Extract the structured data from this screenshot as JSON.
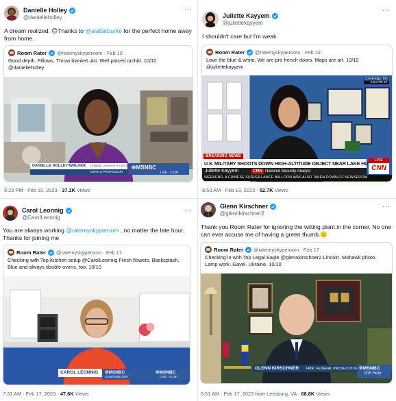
{
  "tweets": [
    {
      "name": "Danielle Holley",
      "handle": "@danielleholley",
      "text_pre": "A dream realized. 😊Thanks to ",
      "mention": "@alafairburke",
      "text_post": " for the perfect home away from home.",
      "quote": {
        "name": "Room Rater",
        "handle": "@ratemyskyperoom · Feb 10",
        "text": "Good depth. Pillows. Throw blanket. Art. Well placed orchid. 10/10 @danielleholley"
      },
      "lower_third": {
        "name": "DANIELLE HOLLEY-WALKER",
        "title": "DEAN & PROFESSOR",
        "org": "HOWARD UNIVERSITY LAW SCHOOL",
        "network": "MSNBC",
        "live": "LIVE",
        "time": "2:12P"
      },
      "meta_time": "5:23 PM · Feb 10, 2023 · ",
      "meta_views": "37.1K",
      "meta_suffix": " Views"
    },
    {
      "name": "Juliette Kayyem",
      "handle": "@juliettekayyem",
      "text": "I shouldn't care but I'm weak.",
      "quote": {
        "name": "Room Rater",
        "handle": "@ratemyskyperoom · Feb 12",
        "text": "Love the blue & white. We are pro french doors. Maps are art. 10/10 @juliettekayyem"
      },
      "lower_third": {
        "location": "Cambridge, MA",
        "clock": "5:54 PM ET",
        "breaking": "BREAKING NEWS",
        "headline": "U.S. MILITARY SHOOTS DOWN HIGH-ALTITUDE OBJECT NEAR LAKE HURON",
        "name": "Juliette Kayyem",
        "network": "CNN",
        "title": "National Security Analyst",
        "live": "LIVE",
        "ticker": "WEEKEND, A CHINESE SURVEILLANCE BALLOON WAS ALSO TAKEN DOWN OF NEWSROOM"
      },
      "meta_time": "8:53 AM · Feb 13, 2023 · ",
      "meta_views": "52.7K",
      "meta_suffix": " Views"
    },
    {
      "name": "Carol Leonnig",
      "handle": "@CarolLeonnig",
      "text_pre": "You are always working ",
      "mention": "@ratemyskyperoom",
      "text_post": " , no matter the late hour. Thanks for joining me",
      "quote": {
        "name": "Room Rater",
        "handle": "@ratemyskyperoom · Feb 17",
        "text": "Checking with Top Kitchen setup @CarolLeonnig Fresh flowers. Backsplash. Blue and always double ovens, too. 10/10"
      },
      "lower_third": {
        "name": "CAROL LEONNIG",
        "network": "MSNBC",
        "title": "CONTRIBUTOR",
        "live": "LIVE",
        "time": "8:14P"
      },
      "meta_time": "7:31 AM · Feb 17, 2023 · ",
      "meta_views": "47.6K",
      "meta_suffix": " Views"
    },
    {
      "name": "Glenn Kirschner",
      "handle": "@glennkirschner2",
      "text": "Thank you Room Rater for ignoring the wilting plant in the corner. No one can ever accuse me of having a green thumb.🙂",
      "quote": {
        "name": "Room Rater",
        "handle": "@ratemyskyperoom · Feb 17",
        "text": "Checking in with Top Legal Eagle @glennkirschner2 Lincoln.  Mohawk photo. Lamp work. Gavel. Ukraine. 10/10"
      },
      "lower_third": {
        "name": "GLENN KIRSCHNER",
        "title": "FMR. FEDERAL PROSECUTOR",
        "network": "MSNBC",
        "show": "11th Hour"
      },
      "meta_time": "6:51 AM · Feb 17, 2023 from Leesburg, VA · ",
      "meta_views": "68.8K",
      "meta_suffix": " Views"
    }
  ],
  "more_label": "···",
  "colors": {
    "link": "#1d9bf0",
    "verified": "#1d9bf0",
    "msnbc": "#2f5a9e",
    "cnn_red": "#cc0000"
  }
}
